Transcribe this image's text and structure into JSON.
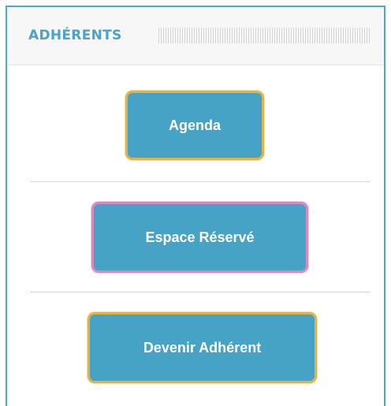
{
  "widget": {
    "title": "ADHÉRENTS"
  },
  "buttons": {
    "agenda": "Agenda",
    "espace_reserve": "Espace Réservé",
    "devenir_adherent": "Devenir Adhérent"
  },
  "colors": {
    "accent": "#4aa3c9",
    "button_bg": "#46a3c5",
    "button_border_gold": "#e0b24a",
    "button_border_pink": "#d789c2"
  }
}
